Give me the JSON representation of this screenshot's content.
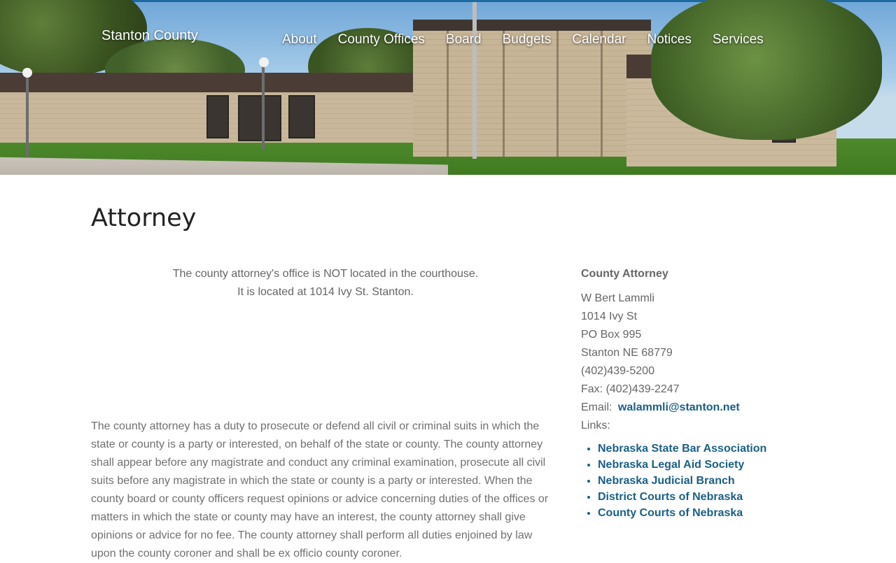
{
  "header": {
    "site_title": "Stanton County",
    "nav": [
      "About",
      "County Offices",
      "Board",
      "Budgets",
      "Calendar",
      "Notices",
      "Services"
    ]
  },
  "page": {
    "title": "Attorney",
    "notice_line1": "The county attorney's office is NOT located in the courthouse.",
    "notice_line2": "It is located at 1014 Ivy St. Stanton.",
    "description": "The county attorney has a duty to prosecute or defend all civil or criminal suits in which the state or county is a party or interested, on behalf of the state or county. The county attorney shall appear before any magistrate and conduct any criminal examination, prosecute all civil suits before any magistrate in which the state or county is a party or interested. When the county board or county officers request opinions or advice concerning duties of the offices or matters in which the state or county may have an interest, the county attorney shall give opinions or advice for no fee. The county attorney shall perform all duties enjoined by law upon the county coroner and shall be ex officio county coroner."
  },
  "sidebar": {
    "heading": "County Attorney",
    "name": "W Bert Lammli",
    "address1": "1014 Ivy St",
    "address2": "PO Box 995",
    "city": "Stanton NE 68779",
    "phone": "(402)439-5200",
    "fax": "Fax: (402)439-2247",
    "email_label": "Email:",
    "email": "walammli@stanton.net",
    "links_label": "Links:",
    "links": [
      "Nebraska State Bar Association",
      "Nebraska Legal Aid Society",
      "Nebraska Judicial Branch",
      "District Courts of Nebraska",
      "County Courts of Nebraska"
    ]
  },
  "colors": {
    "link": "#1b5f86",
    "body_text": "#707070",
    "title": "#222222"
  }
}
